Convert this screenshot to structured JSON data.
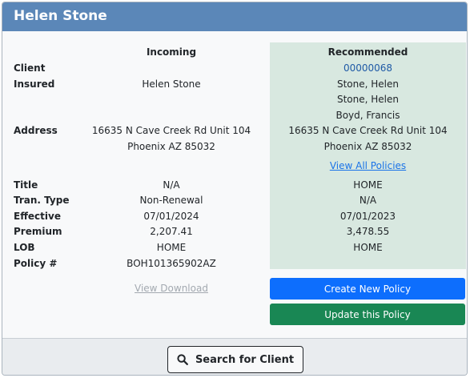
{
  "header": {
    "title": "Helen Stone"
  },
  "columns": {
    "incoming": "Incoming",
    "recommended": "Recommended"
  },
  "labels": {
    "client": "Client",
    "insured": "Insured",
    "address": "Address",
    "title": "Title",
    "tran_type": "Tran. Type",
    "effective": "Effective",
    "premium": "Premium",
    "lob": "LOB",
    "policy": "Policy #"
  },
  "incoming": {
    "insured": "Helen Stone",
    "address_line1": "16635 N Cave Creek Rd Unit 104",
    "address_line2": "Phoenix AZ 85032",
    "title": "N/A",
    "tran_type": "Non-Renewal",
    "effective": "07/01/2024",
    "premium": "2,207.41",
    "lob": "HOME",
    "policy": "BOH101365902AZ",
    "view_download": "View Download"
  },
  "recommended": {
    "client": "00000068",
    "insured": [
      "Stone, Helen",
      "Stone, Helen",
      "Boyd, Francis"
    ],
    "address_line1": "16635 N Cave Creek Rd Unit 104",
    "address_line2": "Phoenix AZ 85032",
    "view_all_policies": "View All Policies",
    "title": "HOME",
    "tran_type": "N/A",
    "effective": "07/01/2023",
    "premium": "3,478.55",
    "lob": "HOME"
  },
  "actions": {
    "create_new_policy": "Create New Policy",
    "update_policy": "Update this Policy",
    "search_client": "Search for Client"
  },
  "colors": {
    "header": "#5b87b8",
    "recommended_panel": "#d8e8e0",
    "primary": "#0d6efd",
    "success": "#198754"
  },
  "icons": {
    "search": "search-icon"
  }
}
